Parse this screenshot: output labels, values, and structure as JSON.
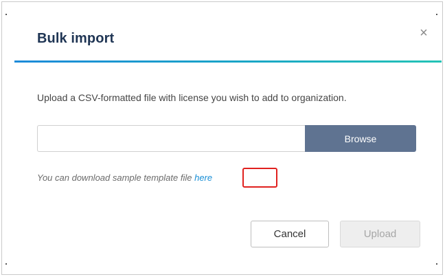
{
  "dialog": {
    "title": "Bulk import",
    "close_glyph": "×",
    "description": "Upload a CSV-formatted file with license you wish to add to organization.",
    "file_input": {
      "value": "",
      "placeholder": ""
    },
    "browse_label": "Browse",
    "hint_text": "You can download sample template file ",
    "hint_link_label": "here",
    "cancel_label": "Cancel",
    "upload_label": "Upload",
    "upload_disabled": true
  },
  "colors": {
    "title": "#1f3554",
    "divider_start": "#1c8ad9",
    "divider_end": "#23c3b6",
    "browse_bg": "#5f7391",
    "link": "#1a8fd6",
    "highlight_box": "#e0201e",
    "upload_disabled_bg": "#eeeeee"
  }
}
